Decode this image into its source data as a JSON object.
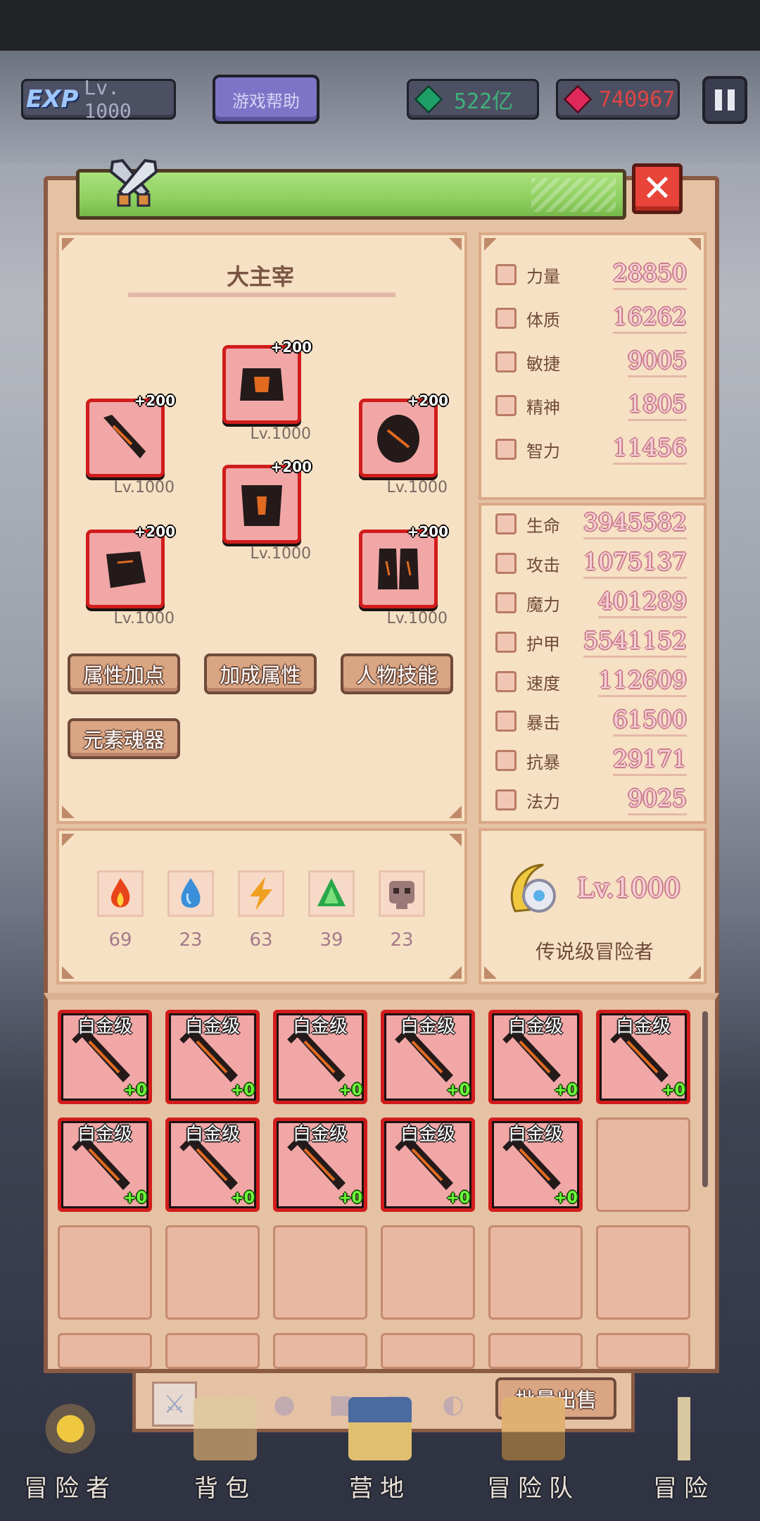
{
  "topbar": {
    "exp_logo": "EXP",
    "level": "Lv. 1000",
    "help_button": "游戏帮助",
    "gems": "522亿",
    "rubies": "740967"
  },
  "panel": {
    "character_name": "大主宰",
    "equipment": [
      {
        "slot": "helmet",
        "plus": "+200",
        "level": "Lv.1000"
      },
      {
        "slot": "weapon",
        "plus": "+200",
        "level": "Lv.1000"
      },
      {
        "slot": "shield",
        "plus": "+200",
        "level": "Lv.1000"
      },
      {
        "slot": "armor",
        "plus": "+200",
        "level": "Lv.1000"
      },
      {
        "slot": "gloves",
        "plus": "+200",
        "level": "Lv.1000"
      },
      {
        "slot": "boots",
        "plus": "+200",
        "level": "Lv.1000"
      }
    ],
    "buttons": {
      "attr_points": "属性加点",
      "bonus_attr": "加成属性",
      "skills": "人物技能",
      "soul_items": "元素魂器"
    },
    "base_stats": [
      {
        "label": "力量",
        "value": "28850"
      },
      {
        "label": "体质",
        "value": "16262"
      },
      {
        "label": "敏捷",
        "value": "9005"
      },
      {
        "label": "精神",
        "value": "1805"
      },
      {
        "label": "智力",
        "value": "11456"
      }
    ],
    "combat_stats": [
      {
        "label": "生命",
        "value": "3945582"
      },
      {
        "label": "攻击",
        "value": "1075137"
      },
      {
        "label": "魔力",
        "value": "401289"
      },
      {
        "label": "护甲",
        "value": "5541152"
      },
      {
        "label": "速度",
        "value": "112609"
      },
      {
        "label": "暴击",
        "value": "61500"
      },
      {
        "label": "抗暴",
        "value": "29171"
      },
      {
        "label": "法力",
        "value": "9025"
      }
    ],
    "elements": [
      {
        "name": "fire",
        "value": "69",
        "color": "#e8441a"
      },
      {
        "name": "water",
        "value": "23",
        "color": "#3a8fd8"
      },
      {
        "name": "lightning",
        "value": "63",
        "color": "#f0a020"
      },
      {
        "name": "earth",
        "value": "39",
        "color": "#28a848"
      },
      {
        "name": "skull",
        "value": "23",
        "color": "#9a7a78"
      }
    ],
    "rank": {
      "level": "Lv.1000",
      "title": "传说级冒险者"
    }
  },
  "inventory": {
    "items": [
      {
        "grade": "白金级",
        "plus": "+0"
      },
      {
        "grade": "白金级",
        "plus": "+0"
      },
      {
        "grade": "白金级",
        "plus": "+0"
      },
      {
        "grade": "白金级",
        "plus": "+0"
      },
      {
        "grade": "白金级",
        "plus": "+0"
      },
      {
        "grade": "白金级",
        "plus": "+0"
      },
      {
        "grade": "白金级",
        "plus": "+0"
      },
      {
        "grade": "白金级",
        "plus": "+0"
      },
      {
        "grade": "白金级",
        "plus": "+0"
      },
      {
        "grade": "白金级",
        "plus": "+0"
      },
      {
        "grade": "白金级",
        "plus": "+0"
      }
    ],
    "bulk_sell": "批量出售"
  },
  "bottom_nav": [
    {
      "label": "冒险者"
    },
    {
      "label": "背包"
    },
    {
      "label": "营地"
    },
    {
      "label": "冒险队"
    },
    {
      "label": "冒险"
    }
  ]
}
